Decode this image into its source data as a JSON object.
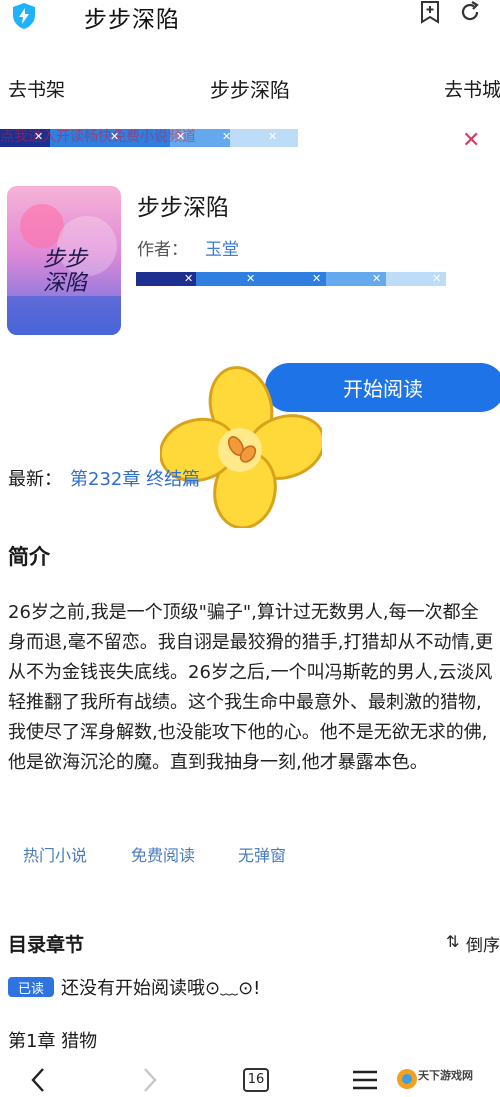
{
  "app": {
    "title": "步步深陷"
  },
  "nav": {
    "left": "去书架",
    "center": "步步深陷",
    "right": "去书城"
  },
  "ad": {
    "text": "点我进入开读畅快免费小说频道"
  },
  "book": {
    "title": "步步深陷",
    "author_label": "作者：",
    "author_name": "玉堂",
    "start_button": "开始阅读",
    "latest_label": "最新：",
    "latest_chapter": "第232章 终结篇"
  },
  "intro": {
    "heading": "简介",
    "text": "26岁之前,我是一个顶级\"骗子\",算计过无数男人,每一次都全身而退,毫不留恋。我自诩是最狡猾的猎手,打猎却从不动情,更从不为金钱丧失底线。26岁之后,一个叫冯斯乾的男人,云淡风轻推翻了我所有战绩。这个我生命中最意外、最刺激的猎物,我使尽了浑身解数,也没能攻下他的心。他不是无欲无求的佛,他是欲海沉沦的魔。直到我抽身一刻,他才暴露本色。"
  },
  "tags": [
    "热门小说",
    "免费阅读",
    "无弹窗"
  ],
  "toc": {
    "heading": "目录章节",
    "sort_label": "倒序",
    "badge": "已读",
    "not_started": "还没有开始阅读哦⊙﹏⊙!",
    "chapter_1": "第1章 猎物"
  },
  "bottom": {
    "tab_count": "16",
    "watermark": "天下游戏网"
  },
  "colors": {
    "accent": "#1e73e6",
    "link": "#2f6fd0",
    "close": "#d63a62"
  },
  "icons": [
    "shield-icon",
    "bookmark-add-icon",
    "refresh-icon",
    "close-icon",
    "sort-icon",
    "back-icon",
    "forward-icon",
    "tabs-icon",
    "menu-icon"
  ]
}
